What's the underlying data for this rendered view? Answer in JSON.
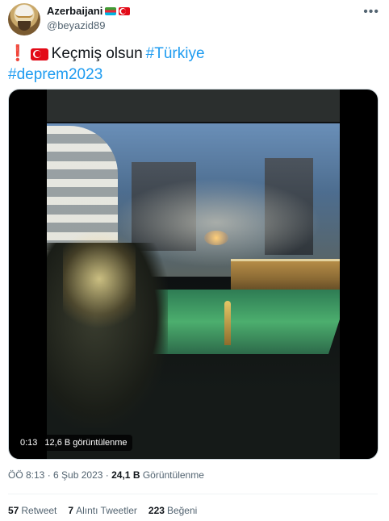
{
  "author": {
    "display_name": "Azerbaijani",
    "handle": "@beyazid89"
  },
  "tweet": {
    "text_part1": "Keçmiş olsun",
    "hashtag1": "#Türkiye",
    "hashtag2": "#deprem2023"
  },
  "video": {
    "timestamp": "0:13",
    "views_overlay": "12,6 B görüntülenme"
  },
  "meta": {
    "time": "ÖÖ 8:13",
    "date": "6 Şub 2023",
    "views_count": "24,1 B",
    "views_label": "Görüntülenme"
  },
  "stats": {
    "retweets_count": "57",
    "retweets_label": "Retweet",
    "quotes_count": "7",
    "quotes_label": "Alıntı Tweetler",
    "likes_count": "223",
    "likes_label": "Beğeni"
  },
  "colors": {
    "link": "#1d9bf0",
    "secondary_text": "#536471",
    "primary_text": "#0f1419"
  },
  "icons": {
    "more": "more-options-icon",
    "exclamation": "red-exclamation-icon",
    "turkey_flag": "turkey-flag-icon",
    "azerbaijan_flag": "azerbaijan-flag-icon"
  }
}
